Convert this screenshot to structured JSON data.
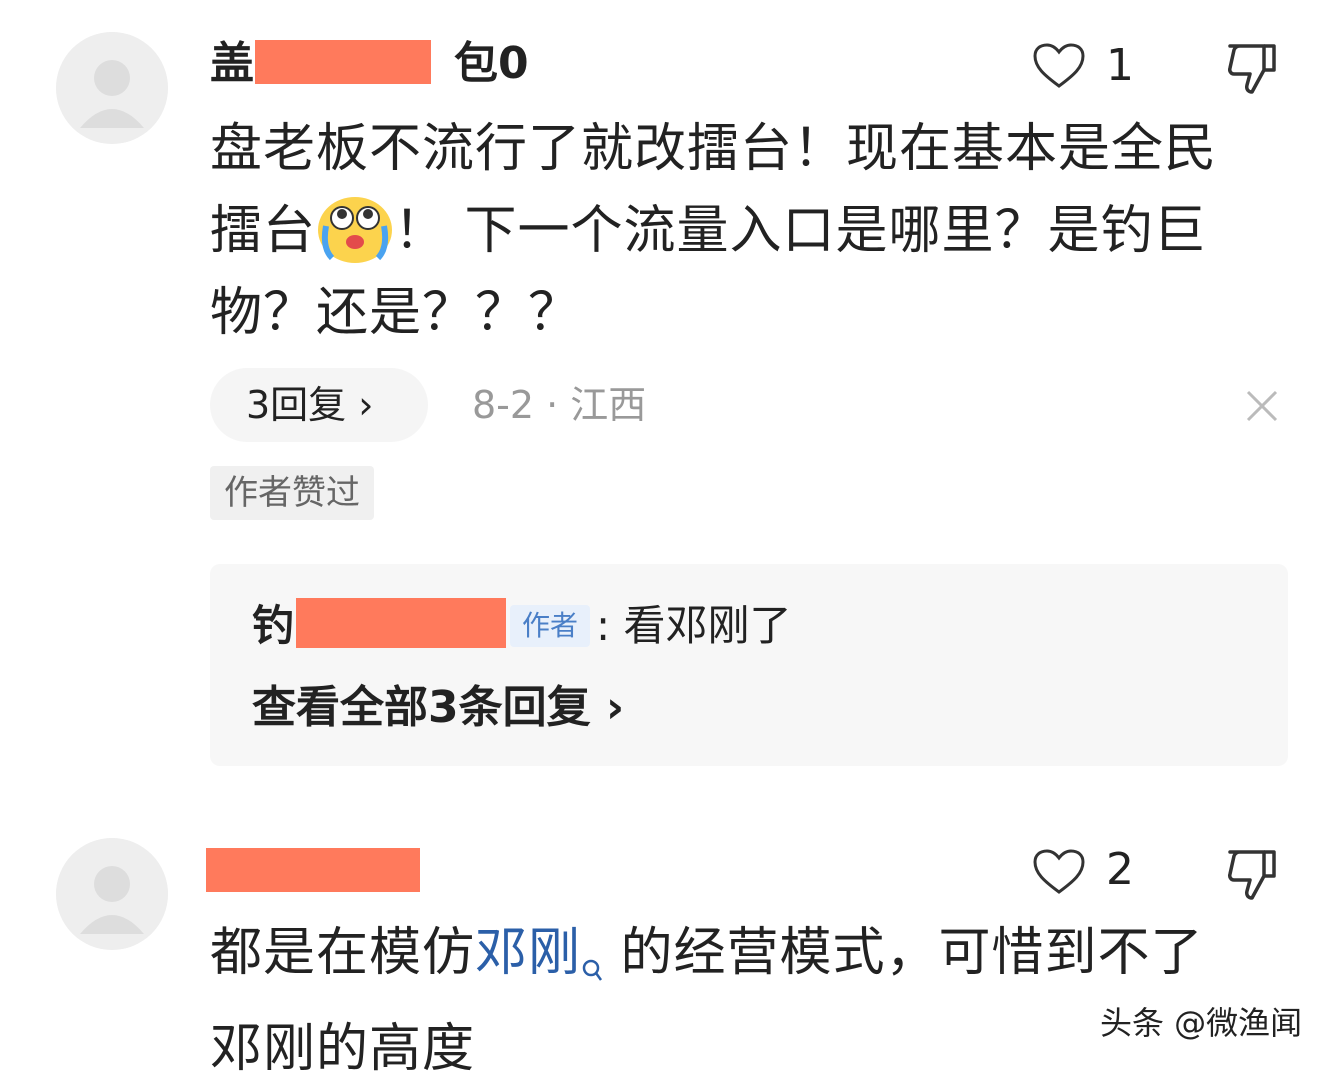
{
  "comments": [
    {
      "username_visible_start": "盖",
      "username_visible_end": "包0",
      "like_count": "1",
      "text_line1": "盘老板不流行了就改擂台！现在基本是全民",
      "text_line2_a": "擂台",
      "text_line2_b": "！ 下一个流量入口是哪里？是钓巨",
      "text_line3": "物？还是？？？",
      "replies_label": "3回复",
      "replies_chevron": "›",
      "date_location": "8-2 · 江西",
      "close_symbol": "×",
      "author_liked_tag": "作者赞过",
      "reply_preview": {
        "author_visible_start": "钓",
        "author_badge": "作者",
        "text": ": 看邓刚了"
      },
      "view_all_label": "查看全部3条回复",
      "view_all_chevron": "›"
    },
    {
      "like_count": "2",
      "text_line1_a": "都是在模仿",
      "text_line1_link": "邓刚",
      "text_line1_b": " 的经营模式，可惜到不了",
      "text_line2": "邓刚的高度"
    }
  ],
  "watermark": "头条 @微渔闻",
  "icons": {
    "like": "heart-outline-icon",
    "dislike": "thumbs-down-icon",
    "avatar": "default-avatar-icon",
    "emoji": "crying-face-emoji",
    "search": "search-icon",
    "close": "close-icon",
    "chevron": "chevron-right-icon"
  },
  "colors": {
    "redaction": "#ff7a5c",
    "link": "#2b5fa8",
    "author_badge_bg": "#e8f0fb",
    "author_badge_text": "#4a7fc7",
    "meta_text": "#999999"
  }
}
